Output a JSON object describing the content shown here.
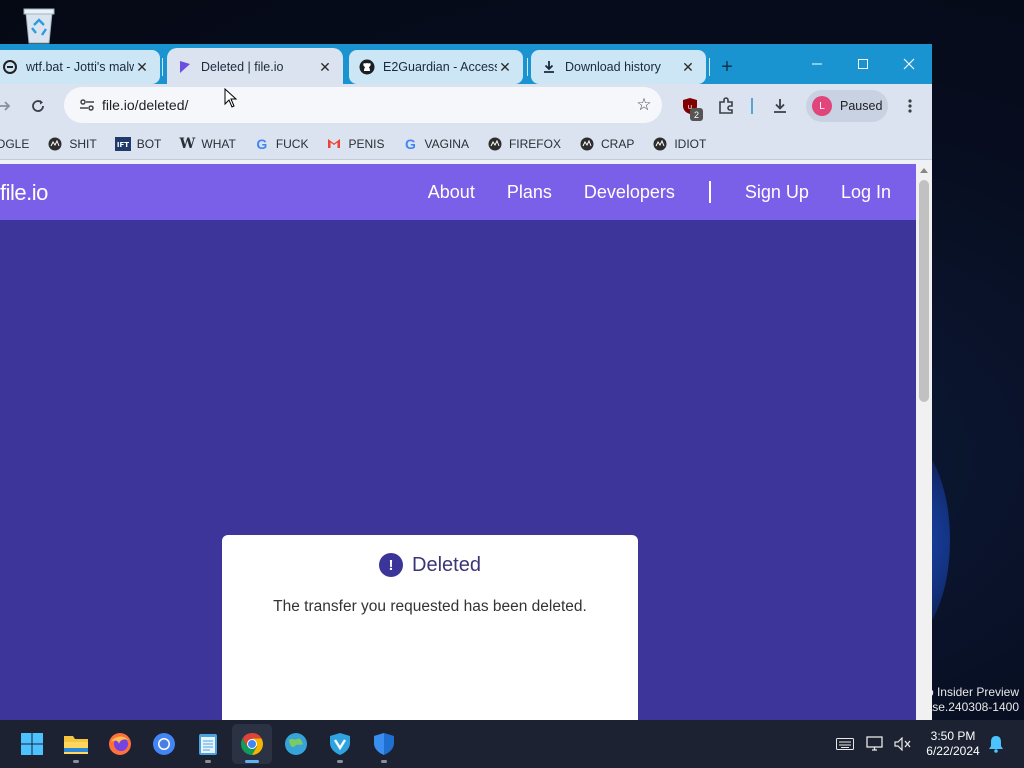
{
  "desktop": {
    "watermark_line1": "o Insider Preview",
    "watermark_line2": "ease.240308-1400"
  },
  "browser": {
    "tabs": [
      {
        "title": "wtf.bat - Jotti's malwa",
        "icon": "jotti-icon"
      },
      {
        "title": "Deleted | file.io",
        "icon": "fileio-icon",
        "active": true
      },
      {
        "title": "E2Guardian - Access",
        "icon": "github-icon"
      },
      {
        "title": "Download history",
        "icon": "download-icon"
      }
    ],
    "url": "file.io/deleted/",
    "profile_status": "Paused",
    "profile_initial": "L",
    "extension_badge": "2",
    "bookmarks": [
      {
        "label": "OGLE",
        "icon": "g"
      },
      {
        "label": "SHIT",
        "icon": "globe"
      },
      {
        "label": "BOT",
        "icon": "ift"
      },
      {
        "label": "WHAT",
        "icon": "w"
      },
      {
        "label": "FUCK",
        "icon": "g"
      },
      {
        "label": "PENIS",
        "icon": "m"
      },
      {
        "label": "VAGINA",
        "icon": "g"
      },
      {
        "label": "FIREFOX",
        "icon": "globe"
      },
      {
        "label": "CRAP",
        "icon": "globe"
      },
      {
        "label": "IDIOT",
        "icon": "globe"
      }
    ]
  },
  "site": {
    "logo": "file.io",
    "nav": {
      "about": "About",
      "plans": "Plans",
      "developers": "Developers",
      "signup": "Sign Up",
      "login": "Log In"
    },
    "card": {
      "title": "Deleted",
      "message": "The transfer you requested has been deleted."
    },
    "colors": {
      "header": "#7a5fe8",
      "background": "#3d3599",
      "accent": "#3b3599"
    }
  },
  "taskbar": {
    "time": "3:50 PM",
    "date": "6/22/2024"
  }
}
